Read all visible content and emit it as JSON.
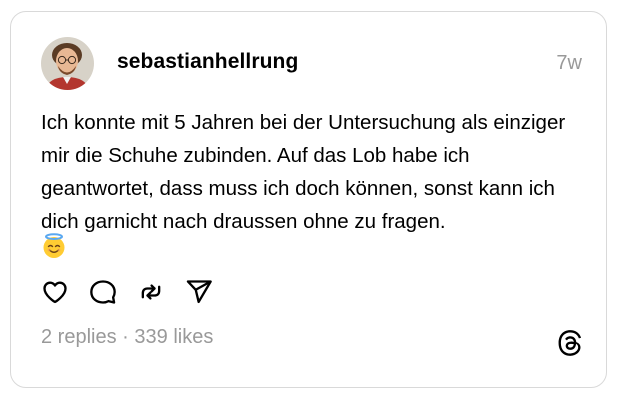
{
  "post": {
    "username": "sebastianhellrung",
    "timestamp": "7w",
    "text": "Ich konnte mit 5 Jahren bei der Untersuchung als einziger mir die Schuhe zubinden. Auf das Lob habe ich geantwortet, dass muss ich doch können, sonst kann ich dich garnicht nach draussen ohne zu fragen.",
    "emoji": "smiling-face-with-halo",
    "replies": "2 replies",
    "separator": "·",
    "likes": "339 likes"
  },
  "icons": {
    "like": "heart-icon",
    "reply": "comment-icon",
    "repost": "repost-icon",
    "share": "send-icon",
    "brand": "threads-logo-icon"
  },
  "colors": {
    "text": "#000000",
    "muted": "#999999",
    "border": "#d9d9d9"
  }
}
